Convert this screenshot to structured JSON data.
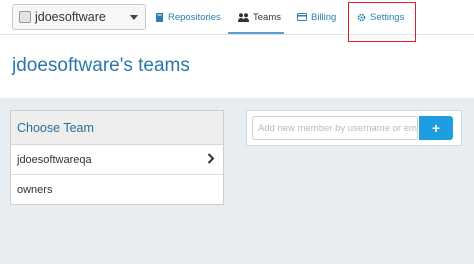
{
  "nav": {
    "org_name": "jdoesoftware",
    "tabs": {
      "repositories": "Repositories",
      "teams": "Teams",
      "billing": "Billing",
      "settings": "Settings"
    },
    "active_tab": "Teams"
  },
  "page": {
    "title": "jdoesoftware's teams"
  },
  "teams_panel": {
    "header": "Choose Team",
    "teams": [
      "jdoesoftwareqa",
      "owners"
    ]
  },
  "members_panel": {
    "input_placeholder": "Add new member by username or email",
    "add_button_label": "+"
  },
  "colors": {
    "accent": "#1e9de0",
    "link": "#2a7fb3",
    "highlight": "#d9202a"
  },
  "icons": [
    "chevron-down-icon",
    "book-icon",
    "users-icon",
    "credit-card-icon",
    "gear-icon",
    "chevron-right-icon"
  ]
}
